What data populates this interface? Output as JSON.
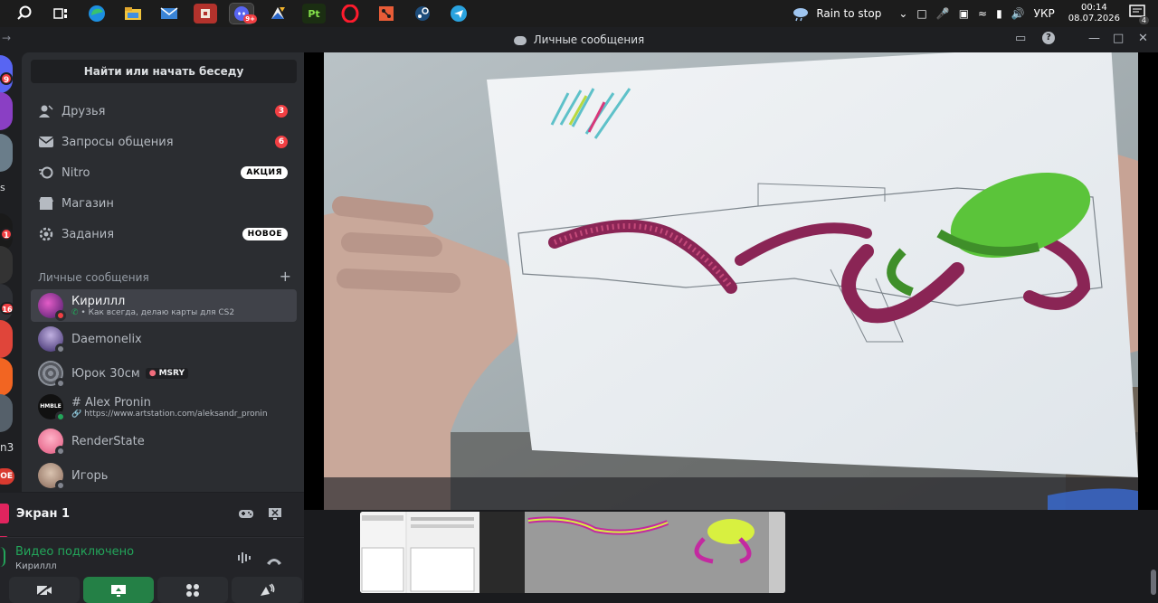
{
  "taskbar": {
    "apps": [
      "search-icon",
      "task-view-icon",
      "edge-icon",
      "file-explorer-icon",
      "mail-icon",
      "roblox-icon",
      "discord-icon",
      "blender-icon",
      "pt-icon",
      "opera-icon",
      "todo-icon",
      "steam-icon",
      "telegram-icon"
    ],
    "discord_badge": "9+",
    "pt_label": "Pt",
    "weather": "Rain to stop",
    "language": "УКР",
    "time": "00:14",
    "date": "08.07.2026",
    "notifications": "4"
  },
  "window": {
    "title": "Личные сообщения"
  },
  "rail": {
    "badges": [
      "9",
      "1",
      "16"
    ],
    "partial_labels": [
      "s",
      "n3",
      "OE"
    ]
  },
  "sidebar": {
    "find_button": "Найти или начать беседу",
    "nav": [
      {
        "label": "Друзья",
        "icon": "friends-icon",
        "badge": "3"
      },
      {
        "label": "Запросы общения",
        "icon": "message-requests-icon",
        "badge": "6"
      },
      {
        "label": "Nitro",
        "icon": "nitro-icon",
        "pill": "АКЦИЯ"
      },
      {
        "label": "Магазин",
        "icon": "shop-icon"
      },
      {
        "label": "Задания",
        "icon": "quests-icon",
        "pill": "НОВОЕ"
      }
    ],
    "dm_header": "Личные сообщения",
    "dms": [
      {
        "name": "Кириллл",
        "sub": "Как всегда, делаю карты для CS2",
        "status": "dnd",
        "color": "#7b3fa8"
      },
      {
        "name": "Daemonelix",
        "status": "offline",
        "color": "#5b4a8a"
      },
      {
        "name": "Юрок 30см",
        "tag": "MSRY",
        "status": "offline",
        "color": "#6b6f78"
      },
      {
        "name": "# Alex Pronin",
        "sub": "https://www.artstation.com/aleksandr_pronin",
        "avatar_text": "HMBLE",
        "status": "online",
        "color": "#111111"
      },
      {
        "name": "RenderState",
        "status": "offline",
        "color": "#e0577e"
      },
      {
        "name": "Игорь",
        "status": "offline",
        "color": "#8a6a5a"
      }
    ]
  },
  "screenshare": {
    "title": "Экран 1"
  },
  "rtc": {
    "status": "Видео подключено",
    "user": "Кириллл"
  },
  "colors": {
    "accent_green": "#23a55a",
    "danger_red": "#f23f43",
    "panel": "#2b2d31"
  }
}
